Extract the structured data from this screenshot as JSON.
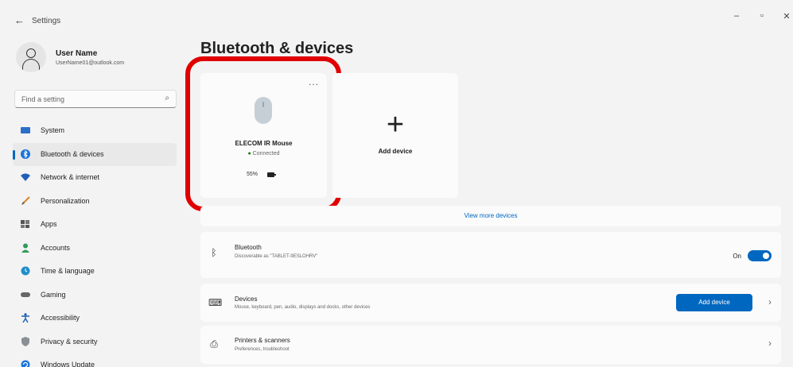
{
  "window": {
    "title": "Settings",
    "back_glyph": "←",
    "minimize_glyph": "–",
    "maximize_glyph": "▫",
    "close_glyph": "✕"
  },
  "user": {
    "name": "User Name",
    "email": "UserName01@outlook.com"
  },
  "search": {
    "placeholder": "Find a setting",
    "icon": "search-icon"
  },
  "nav": {
    "items": [
      {
        "label": "System",
        "icon": "system-icon",
        "active": false
      },
      {
        "label": "Bluetooth & devices",
        "icon": "bluetooth-icon",
        "active": true
      },
      {
        "label": "Network & internet",
        "icon": "wifi-icon",
        "active": false
      },
      {
        "label": "Personalization",
        "icon": "brush-icon",
        "active": false
      },
      {
        "label": "Apps",
        "icon": "apps-icon",
        "active": false
      },
      {
        "label": "Accounts",
        "icon": "person-icon",
        "active": false
      },
      {
        "label": "Time & language",
        "icon": "globe-clock-icon",
        "active": false
      },
      {
        "label": "Gaming",
        "icon": "gamepad-icon",
        "active": false
      },
      {
        "label": "Accessibility",
        "icon": "accessibility-icon",
        "active": false
      },
      {
        "label": "Privacy & security",
        "icon": "shield-icon",
        "active": false
      },
      {
        "label": "Windows Update",
        "icon": "update-icon",
        "active": false
      }
    ]
  },
  "page": {
    "title": "Bluetooth & devices"
  },
  "device": {
    "name": "ELECOM IR Mouse",
    "status": "Connected",
    "battery": "55%",
    "battery_level_percent": 55,
    "menu_glyph": "..."
  },
  "add_device_card": {
    "plus": "+",
    "label": "Add device"
  },
  "view_more": "View more devices",
  "bluetooth": {
    "title": "Bluetooth",
    "subtitle": "Discoverable as \"TABLET-9ESLOHRV\"",
    "toggle_label": "On",
    "toggle_on": true
  },
  "devices_row": {
    "title": "Devices",
    "subtitle": "Mouse, keyboard, pen, audio, displays and docks, other devices",
    "button_label": "Add device"
  },
  "printers_row": {
    "title": "Printers & scanners",
    "subtitle": "Preferences, troubleshoot"
  },
  "colors": {
    "accent": "#0067c0",
    "highlight": "#e00000",
    "connected": "#107c10"
  }
}
